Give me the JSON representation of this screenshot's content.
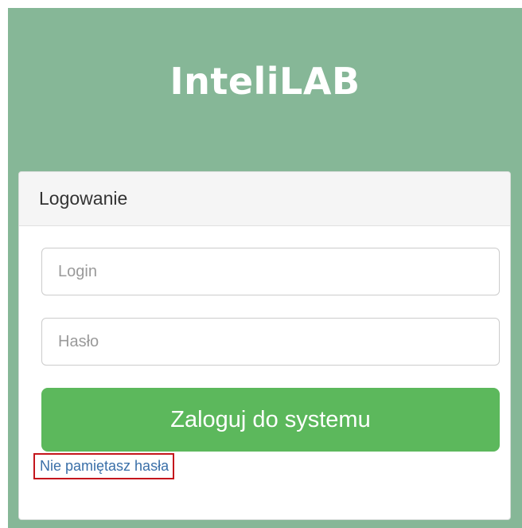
{
  "app": {
    "name": "InteliLAB"
  },
  "login_panel": {
    "heading": "Logowanie",
    "login_placeholder": "Login",
    "password_placeholder": "Hasło",
    "submit_label": "Zaloguj do systemu",
    "forgot_password_link": "Nie pamiętasz hasła"
  },
  "colors": {
    "header_background": "#86b797",
    "button_background": "#5cb85c",
    "link": "#3a6fa8",
    "highlight_border": "#c4161c"
  }
}
